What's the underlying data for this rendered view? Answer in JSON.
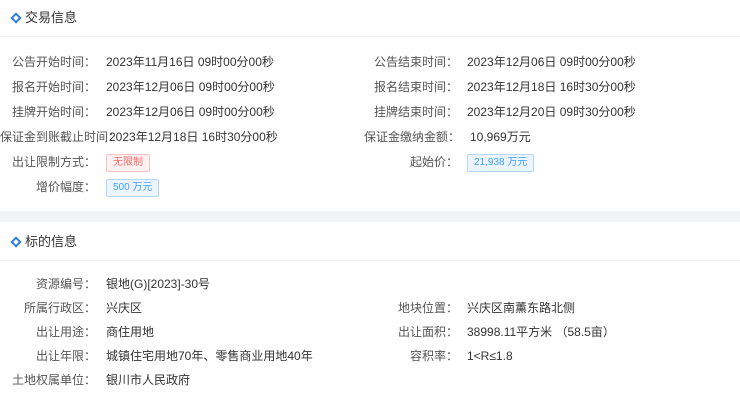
{
  "trade": {
    "title": "交易信息",
    "notice_start_label": "公告开始时间：",
    "notice_start": "2023年11月16日 09时00分00秒",
    "notice_end_label": "公告结束时间：",
    "notice_end": "2023年12月06日 09时00分00秒",
    "reg_start_label": "报名开始时间：",
    "reg_start": "2023年12月06日 09时00分00秒",
    "reg_end_label": "报名结束时间：",
    "reg_end": "2023年12月18日 16时30分00秒",
    "list_start_label": "挂牌开始时间：",
    "list_start": "2023年12月06日 09时00分00秒",
    "list_end_label": "挂牌结束时间：",
    "list_end": "2023年12月20日 09时30分00秒",
    "deposit_deadline_label": "保证金到账截止时间：",
    "deposit_deadline": "2023年12月18日 16时30分00秒",
    "deposit_amount_label": "保证金缴纳金额：",
    "deposit_amount": "10,969万元",
    "restriction_label": "出让限制方式：",
    "restriction": "无限制",
    "start_price_label": "起始价：",
    "start_price": "21,938 万元",
    "increment_label": "增价幅度：",
    "increment": "500 万元"
  },
  "subject": {
    "title": "标的信息",
    "resource_no_label": "资源编号：",
    "resource_no": "银地(G)[2023]-30号",
    "district_label": "所属行政区：",
    "district": "兴庆区",
    "location_label": "地块位置：",
    "location": "兴庆区南薰东路北侧",
    "usage_label": "出让用途：",
    "usage": "商住用地",
    "area_label": "出让面积：",
    "area": "38998.11平方米 （58.5亩）",
    "term_label": "出让年限：",
    "term": "城镇住宅用地70年、零售商业用地40年",
    "far_label": "容积率：",
    "far": "1<R≤1.8",
    "owner_label": "土地权属单位：",
    "owner": "银川市人民政府"
  },
  "colors": {
    "accent": "#2f7fe0",
    "tag_red": "#f56c6c",
    "tag_blue": "#409eff"
  }
}
